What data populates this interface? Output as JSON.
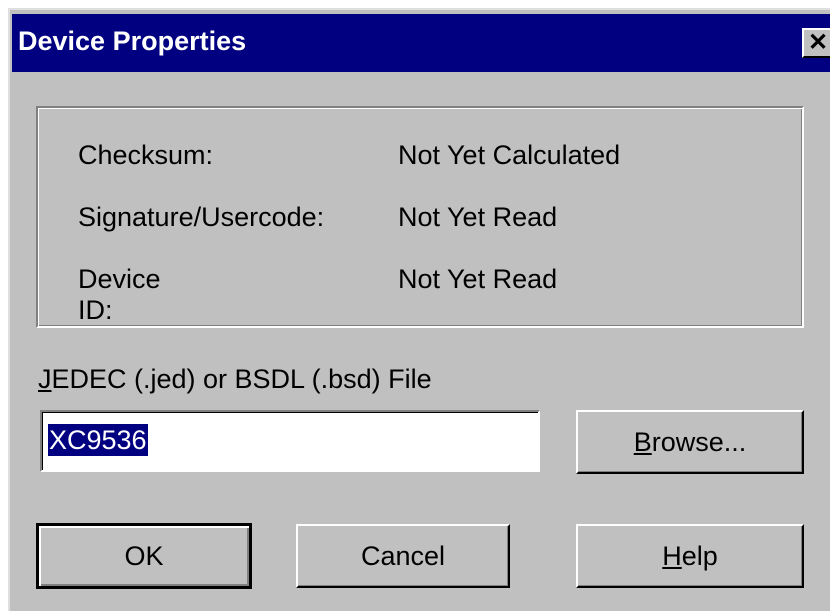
{
  "window": {
    "title": "Device Properties",
    "close_symbol": "✕"
  },
  "info": {
    "rows": [
      {
        "label": "Checksum:",
        "value": "Not Yet Calculated"
      },
      {
        "label": "Signature/Usercode:",
        "value": "Not Yet Read"
      },
      {
        "label": "Device ID:",
        "value": "Not Yet Read"
      }
    ]
  },
  "file": {
    "label_mnemonic": "J",
    "label_rest": "EDEC (.jed) or BSDL (.bsd) File",
    "value": "XC9536"
  },
  "buttons": {
    "browse_mnemonic": "B",
    "browse_rest": "rowse...",
    "ok": "OK",
    "cancel": "Cancel",
    "help_mnemonic": "H",
    "help_rest": "elp"
  },
  "colors": {
    "titlebar": "#000080",
    "face": "#c0c0c0",
    "selection": "#000080"
  }
}
